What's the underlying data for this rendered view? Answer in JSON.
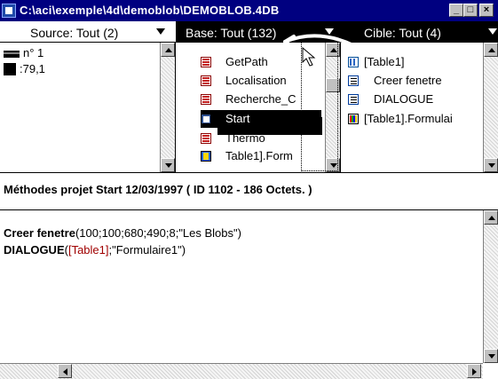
{
  "window": {
    "title": "C:\\aci\\exemple\\4d\\demoblob\\DEMOBLOB.4DB",
    "minimize": "_",
    "maximize": "□",
    "close": "×"
  },
  "headers": {
    "source": "Source: Tout (2)",
    "base": "Base: Tout (132)",
    "cible": "Cible: Tout (4)"
  },
  "left_panel": {
    "items": [
      {
        "icon": "line-icon",
        "label": "n° 1"
      },
      {
        "icon": "printer-icon",
        "label": ":79,1"
      }
    ]
  },
  "mid_panel": {
    "items": [
      {
        "icon": "grid-icon",
        "label": "GetPath"
      },
      {
        "icon": "grid-icon",
        "label": "Localisation"
      },
      {
        "icon": "grid-icon",
        "label": "Recherche_C"
      },
      {
        "icon": "start-icon",
        "label": "Start",
        "selected": true
      },
      {
        "icon": "grid-icon",
        "label": "Thermo"
      },
      {
        "icon": "form-icon",
        "label": "Table1].Form"
      }
    ]
  },
  "right_panel": {
    "items": [
      {
        "icon": "table-icon",
        "label": "[Table1]"
      },
      {
        "icon": "window-icon",
        "label": "Creer fenetre"
      },
      {
        "icon": "window-icon",
        "label": "DIALOGUE"
      },
      {
        "icon": "palette-icon",
        "label": "[Table1].Formulai"
      }
    ]
  },
  "info": {
    "text": "Méthodes projet Start  12/03/1997 ( ID 1102 - 186 Octets. )"
  },
  "editor": {
    "lines": [
      {
        "kw": "Creer fenetre",
        "args": "(100;100;680;490;8;\"Les Blobs\")"
      },
      {
        "kw": "DIALOGUE",
        "args_pre": "(",
        "tbl": "[Table1]",
        "args_post": ";\"Formulaire1\")"
      }
    ]
  },
  "colors": {
    "titlebar": "#000080",
    "panel_bg": "#ffffff",
    "selected_bg": "#000000",
    "text": "#000000",
    "table_ref": "#a00000"
  }
}
